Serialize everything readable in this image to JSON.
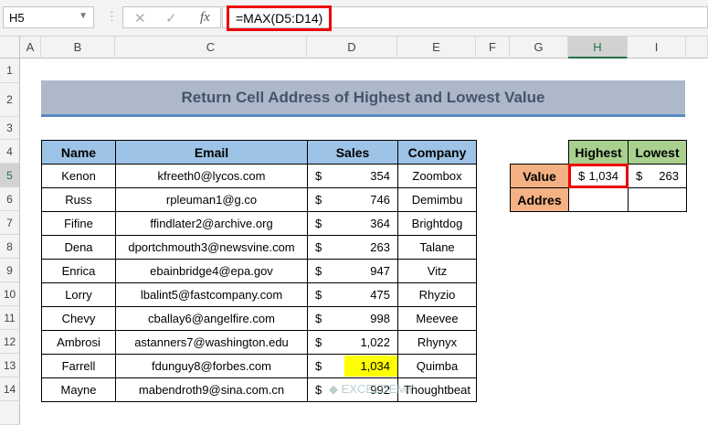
{
  "namebox": "H5",
  "formula": "=MAX(D5:D14)",
  "columns": [
    "A",
    "B",
    "C",
    "D",
    "E",
    "F",
    "G",
    "H",
    "I"
  ],
  "rows": [
    "1",
    "2",
    "3",
    "4",
    "5",
    "6",
    "7",
    "8",
    "9",
    "10",
    "11",
    "12",
    "13",
    "14"
  ],
  "title": "Return Cell Address of Highest and Lowest Value",
  "table": {
    "headers": [
      "Name",
      "Email",
      "Sales",
      "Company"
    ],
    "currency": "$",
    "rows": [
      [
        "Kenon",
        "kfreeth0@lycos.com",
        "354",
        "Zoombox"
      ],
      [
        "Russ",
        "rpleuman1@g.co",
        "746",
        "Demimbu"
      ],
      [
        "Fifine",
        "ffindlater2@archive.org",
        "364",
        "Brightdog"
      ],
      [
        "Dena",
        "dportchmouth3@newsvine.com",
        "263",
        "Talane"
      ],
      [
        "Enrica",
        "ebainbridge4@epa.gov",
        "947",
        "Vitz"
      ],
      [
        "Lorry",
        "lbalint5@fastcompany.com",
        "475",
        "Rhyzio"
      ],
      [
        "Chevy",
        "cballay6@angelfire.com",
        "998",
        "Meevee"
      ],
      [
        "Ambrosi",
        "astanners7@washington.edu",
        "1,022",
        "Rhynyx"
      ],
      [
        "Farrell",
        "fdunguy8@forbes.com",
        "1,034",
        "Quimba"
      ],
      [
        "Mayne",
        "mabendroth9@sina.com.cn",
        "992",
        "Thoughtbeat"
      ]
    ],
    "highlight_row": 8,
    "highlight_color": "#ffff00"
  },
  "summary": {
    "col_headers": [
      "Highest",
      "Lowest"
    ],
    "row_labels": [
      "Value",
      "Addres"
    ],
    "currency": "$",
    "values": [
      "1,034",
      "263"
    ]
  },
  "watermark": "exceldemy"
}
